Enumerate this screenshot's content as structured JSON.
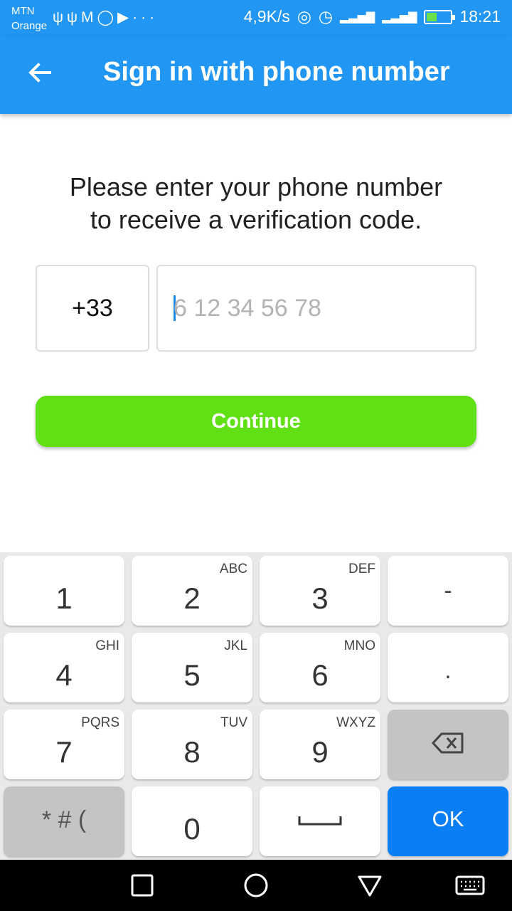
{
  "status_bar": {
    "carrier_line1": "MTN",
    "carrier_line2": "Orange",
    "net_speed": "4,9K/s",
    "time": "18:21",
    "icons": [
      "usb-icon",
      "usb-icon",
      "gmail-icon",
      "whatsapp-icon",
      "youtube-icon",
      "more-icon",
      "hotspot-icon",
      "alarm-icon",
      "signal-icon",
      "signal-4g-icon",
      "battery-charging-icon"
    ]
  },
  "app_bar": {
    "title": "Sign in with phone number",
    "back_icon": "arrow-left-icon",
    "color": "#2196F3"
  },
  "instruction": {
    "line1": "Please enter your phone number",
    "line2": "to receive a verification code."
  },
  "form": {
    "country_code": "+33",
    "phone_value": "",
    "phone_placeholder": "6 12 34 56 78",
    "continue_label": "Continue",
    "continue_color": "#62E016"
  },
  "keyboard": {
    "keys": [
      {
        "main": "1",
        "sub": ""
      },
      {
        "main": "2",
        "sub": "ABC"
      },
      {
        "main": "3",
        "sub": "DEF"
      },
      {
        "main": "-",
        "sub": ""
      },
      {
        "main": "4",
        "sub": "GHI"
      },
      {
        "main": "5",
        "sub": "JKL"
      },
      {
        "main": "6",
        "sub": "MNO"
      },
      {
        "main": ".",
        "sub": ""
      },
      {
        "main": "7",
        "sub": "PQRS"
      },
      {
        "main": "8",
        "sub": "TUV"
      },
      {
        "main": "9",
        "sub": "WXYZ"
      },
      {
        "main": "*#(",
        "sub": ""
      },
      {
        "main": "0",
        "sub": ""
      }
    ],
    "symbols_label": "* # (",
    "ok_label": "OK",
    "ok_color": "#0A7EF5",
    "space_icon": "space-bar-icon",
    "backspace_icon": "backspace-icon"
  },
  "nav_bar": {
    "icons": [
      "recents-square-icon",
      "home-circle-icon",
      "back-triangle-icon",
      "keyboard-icon"
    ]
  }
}
